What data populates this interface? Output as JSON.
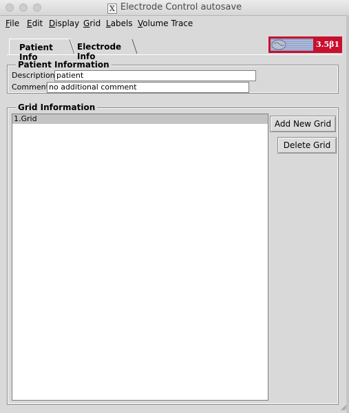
{
  "window": {
    "title": "Electrode Control autosave",
    "x_icon_glyph": "X"
  },
  "menu": [
    {
      "label": "File",
      "mnemonic": "F",
      "rest": "ile"
    },
    {
      "label": "Edit",
      "mnemonic": "E",
      "rest": "dit"
    },
    {
      "label": "Display",
      "mnemonic": "D",
      "rest": "isplay"
    },
    {
      "label": "Grid",
      "mnemonic": "G",
      "rest": "rid"
    },
    {
      "label": "Labels",
      "mnemonic": "L",
      "rest": "abels"
    },
    {
      "label": "Volume Trace",
      "mnemonic": "V",
      "rest": "olume Trace"
    }
  ],
  "tabs": {
    "active": "Patient Info",
    "inactive": "Electrode Info"
  },
  "logo": {
    "version": "3.5β1",
    "color": "#c8102e"
  },
  "patient": {
    "title": "Patient Information",
    "description_label": "Description:",
    "description_value": "patient",
    "comment_label": "Comment:",
    "comment_value": "no additional comment"
  },
  "grid": {
    "title": "Grid Information",
    "items": [
      "1.Grid"
    ],
    "add_label": "Add New Grid",
    "delete_label": "Delete  Grid"
  }
}
